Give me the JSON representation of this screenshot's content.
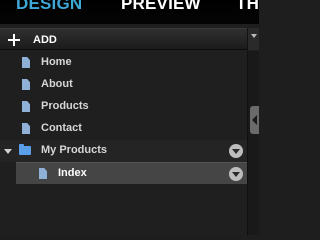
{
  "tabs": [
    {
      "label": "DESIGN",
      "active": true
    },
    {
      "label": "PREVIEW",
      "active": false
    },
    {
      "label": "TH",
      "active": false
    }
  ],
  "toolbar": {
    "add_label": "ADD",
    "add_icon": "plus-icon"
  },
  "tree": {
    "items": [
      {
        "label": "Home",
        "type": "page",
        "icon": "page-icon"
      },
      {
        "label": "About",
        "type": "page",
        "icon": "page-icon"
      },
      {
        "label": "Products",
        "type": "page",
        "icon": "page-icon"
      },
      {
        "label": "Contact",
        "type": "page",
        "icon": "page-icon"
      },
      {
        "label": "My Products",
        "type": "folder",
        "icon": "folder-icon",
        "expanded": true
      },
      {
        "label": "Index",
        "type": "page",
        "icon": "page-icon",
        "selected": true
      }
    ]
  },
  "colors": {
    "accent": "#3ea8d6",
    "selected_row": "#454545",
    "page_icon": "#8fb1d8",
    "folder_icon": "#5aa0e8"
  }
}
